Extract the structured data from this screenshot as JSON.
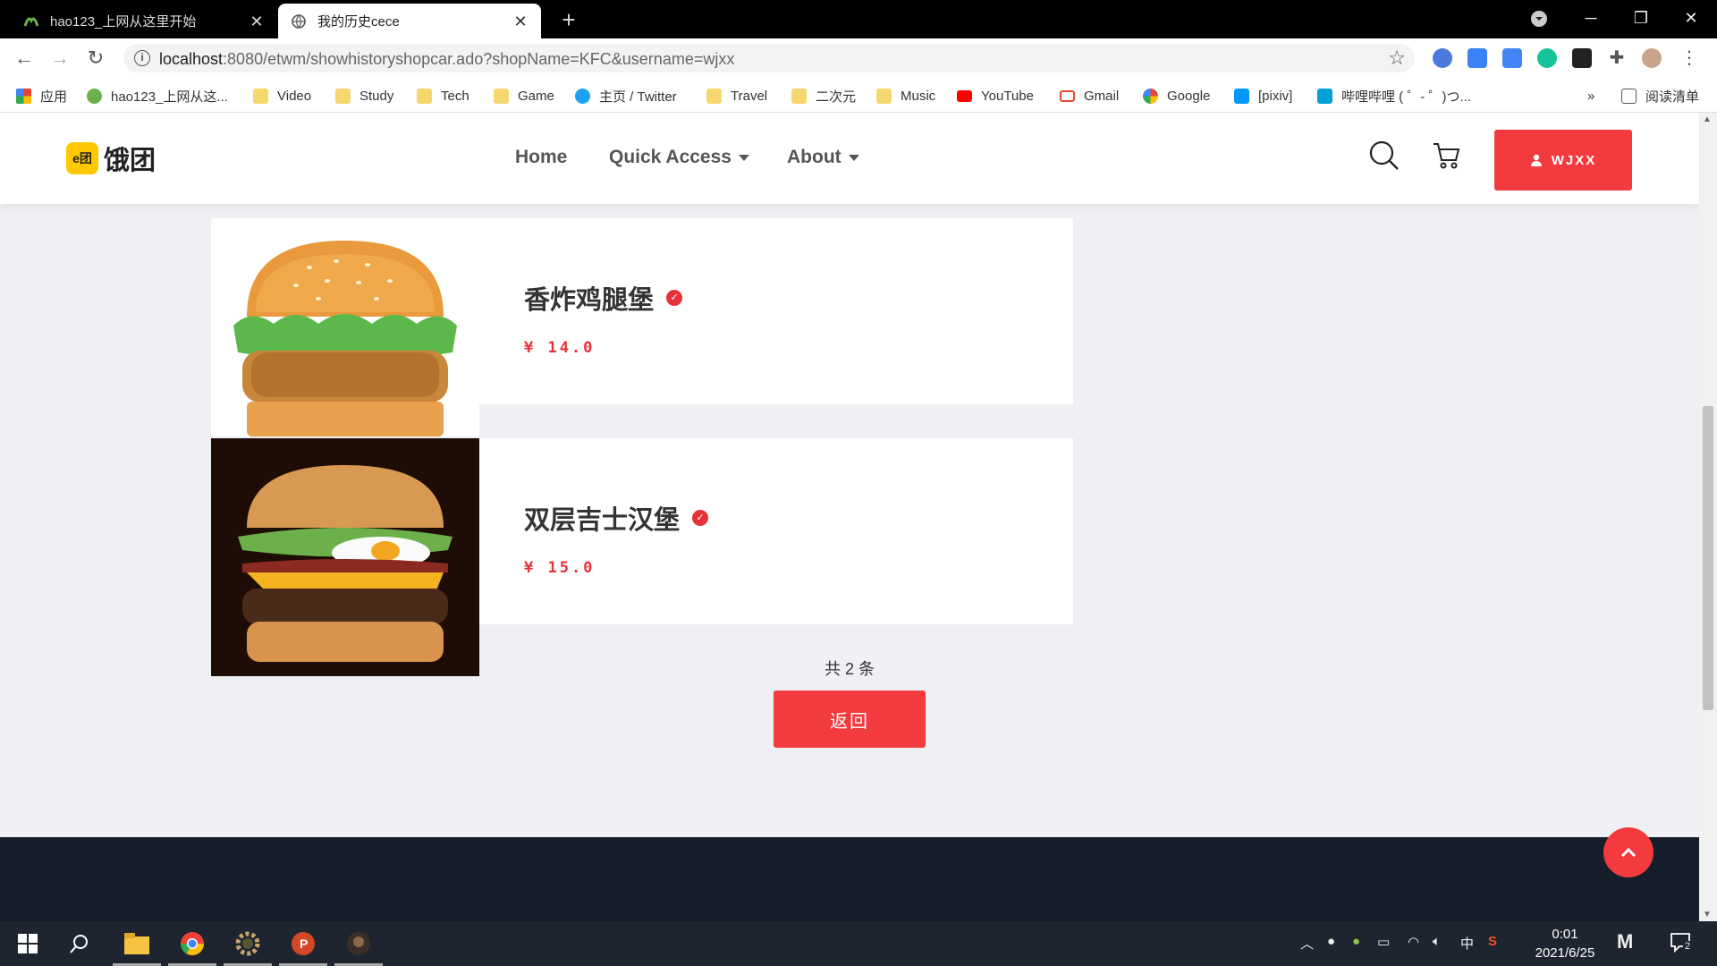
{
  "browser": {
    "tabs": [
      {
        "title": "hao123_上网从这里开始",
        "active": false
      },
      {
        "title": "我的历史cece",
        "active": true
      }
    ],
    "url_host": "localhost",
    "url_rest": ":8080/etwm/showhistoryshopcar.ado?shopName=KFC&username=wjxx",
    "bookmarks": [
      {
        "label": "应用",
        "icon": "apps-grid-icon"
      },
      {
        "label": "hao123_上网从这...",
        "icon": "hao123-icon"
      },
      {
        "label": "Video",
        "icon": "folder-icon"
      },
      {
        "label": "Study",
        "icon": "folder-icon"
      },
      {
        "label": "Tech",
        "icon": "folder-icon"
      },
      {
        "label": "Game",
        "icon": "folder-icon"
      },
      {
        "label": "主页 / Twitter",
        "icon": "twitter-icon"
      },
      {
        "label": "Travel",
        "icon": "folder-icon"
      },
      {
        "label": "二次元",
        "icon": "folder-icon"
      },
      {
        "label": "Music",
        "icon": "folder-icon"
      },
      {
        "label": "YouTube",
        "icon": "youtube-icon"
      },
      {
        "label": "Gmail",
        "icon": "gmail-icon"
      },
      {
        "label": "Google",
        "icon": "google-icon"
      },
      {
        "label": "[pixiv]",
        "icon": "pixiv-icon"
      },
      {
        "label": "哔哩哔哩 ( ゜- ゜)つ...",
        "icon": "bilibili-icon"
      }
    ],
    "reading_list": "阅读清单",
    "more_bookmarks": "»"
  },
  "site": {
    "logo_mark": "e团",
    "logo_name": "饿团",
    "nav": [
      {
        "label": "Home",
        "dropdown": false
      },
      {
        "label": "Quick Access",
        "dropdown": true
      },
      {
        "label": "About",
        "dropdown": true
      }
    ],
    "user_button": "WJXX"
  },
  "history": {
    "items": [
      {
        "name": "香炸鸡腿堡",
        "price": "¥ 14.0"
      },
      {
        "name": "双层吉士汉堡",
        "price": "¥ 15.0"
      }
    ],
    "count_text": "共 2 条",
    "back_button": "返回"
  },
  "taskbar": {
    "time": "0:01",
    "date": "2021/6/25",
    "ime": "中",
    "notifications": "2"
  },
  "colors": {
    "accent": "#f33a3f",
    "footer": "#161d2b",
    "logo_yellow": "#ffc800"
  }
}
